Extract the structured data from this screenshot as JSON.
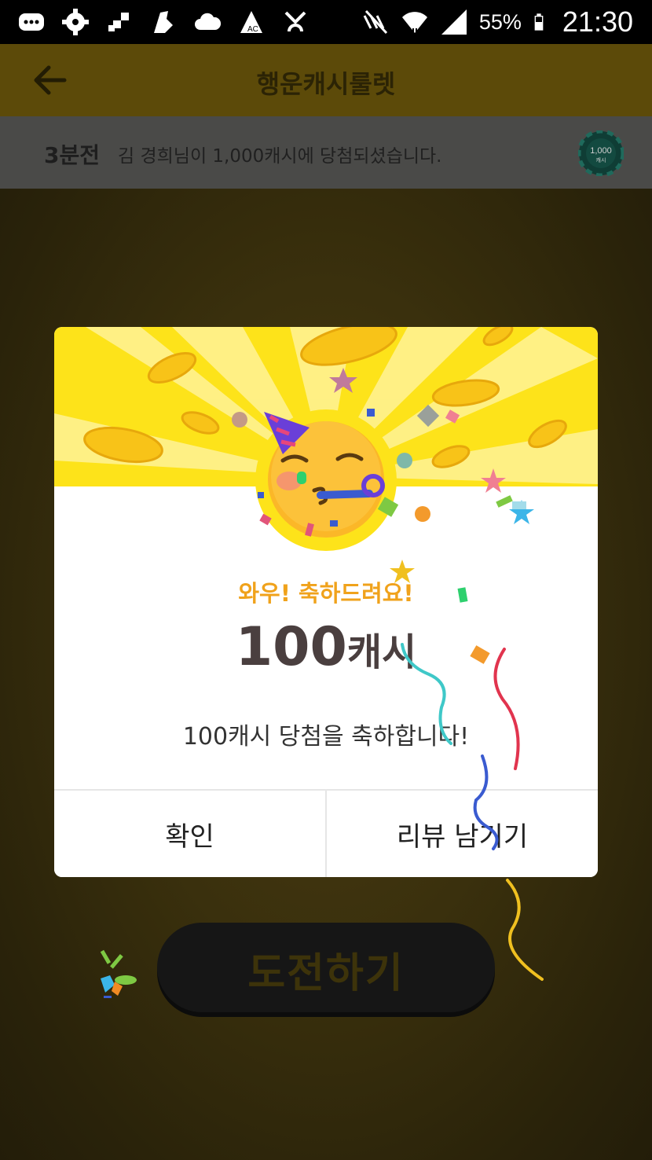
{
  "status_bar": {
    "battery": "55%",
    "time": "21:30",
    "icons": [
      "message-icon",
      "settings-gear-icon",
      "grid-icon",
      "shoe-icon",
      "cloud-icon",
      "ac-icon",
      "fan-icon",
      "mute-icon",
      "wifi-icon",
      "signal-icon",
      "battery-icon"
    ]
  },
  "app_bar": {
    "title": "행운캐시룰렛",
    "back_icon": "back-arrow-icon"
  },
  "ticker": {
    "time": "3분전",
    "message": "김 경희님이 1,000캐시에 당첨되셨습니다.",
    "chip_text": "1,000",
    "chip_subtext": "캐시"
  },
  "modal": {
    "headline": "와우! 축하드려요!",
    "prize_number": "100",
    "prize_unit": "캐시",
    "message": "100캐시 당첨을 축하합니다!",
    "confirm_label": "확인",
    "review_label": "리뷰 남기기"
  },
  "challenge_button": {
    "label": "도전하기"
  },
  "colors": {
    "accent_yellow": "#fde31a",
    "headline_orange": "#f0a21b",
    "prize_text": "#4a3f3f",
    "app_bar_dim": "#5c4a09"
  }
}
